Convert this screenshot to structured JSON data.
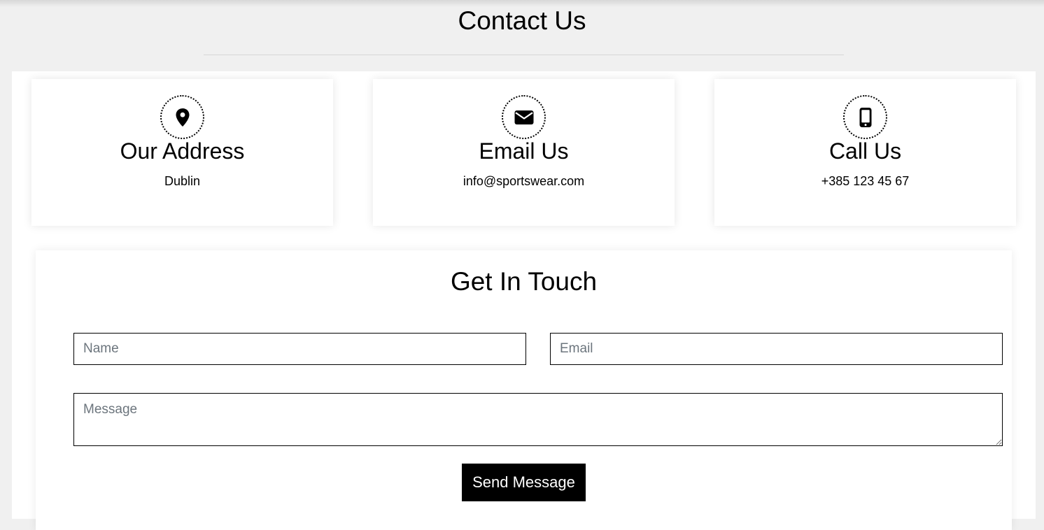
{
  "page": {
    "title": "Contact Us"
  },
  "cards": [
    {
      "icon": "map-marker-icon",
      "title": "Our Address",
      "value": "Dublin"
    },
    {
      "icon": "envelope-icon",
      "title": "Email Us",
      "value": "info@sportswear.com"
    },
    {
      "icon": "mobile-phone-icon",
      "title": "Call Us",
      "value": "+385 123 45 67"
    }
  ],
  "form": {
    "title": "Get In Touch",
    "name_placeholder": "Name",
    "email_placeholder": "Email",
    "message_placeholder": "Message",
    "submit_label": "Send Message"
  }
}
